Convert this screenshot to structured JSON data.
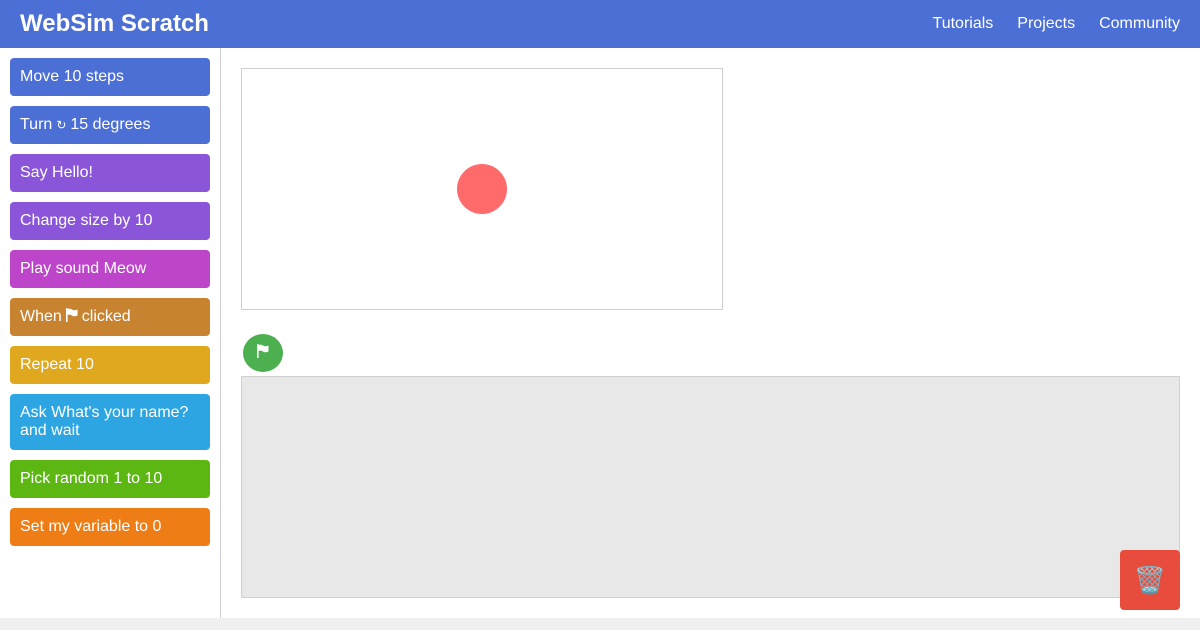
{
  "header": {
    "title": "WebSim Scratch",
    "nav": [
      "Tutorials",
      "Projects",
      "Community"
    ],
    "background": "#4c6fd6"
  },
  "palette": {
    "blocks": [
      {
        "label": "Move 10 steps",
        "color": "#4c6fd6"
      },
      {
        "label_before": "Turn",
        "icon": "rotate-right-icon",
        "icon_glyph": "↻",
        "label_after": "15 degrees",
        "color": "#4c6fd6"
      },
      {
        "label": "Say Hello!",
        "color": "#8a55d8"
      },
      {
        "label": "Change size by 10",
        "color": "#8a55d8"
      },
      {
        "label": "Play sound Meow",
        "color": "#bc45c9"
      },
      {
        "label_before": "When",
        "icon": "flag-icon",
        "label_after": "clicked",
        "color": "#c88330"
      },
      {
        "label": "Repeat 10",
        "color": "#e0a81f"
      },
      {
        "label": "Ask What's your name? and wait",
        "color": "#2ca5e2"
      },
      {
        "label": "Pick random 1 to 10",
        "color": "#5cb712"
      },
      {
        "label": "Set my variable to 0",
        "color": "#ee7d16"
      }
    ]
  },
  "stage": {
    "sprite_color": "#ff6b6b"
  },
  "run": {
    "icon": "flag-icon",
    "color": "#4caf50"
  },
  "trash": {
    "icon": "trash-can-icon",
    "glyph": "🗑️",
    "color": "#e74c3c"
  }
}
